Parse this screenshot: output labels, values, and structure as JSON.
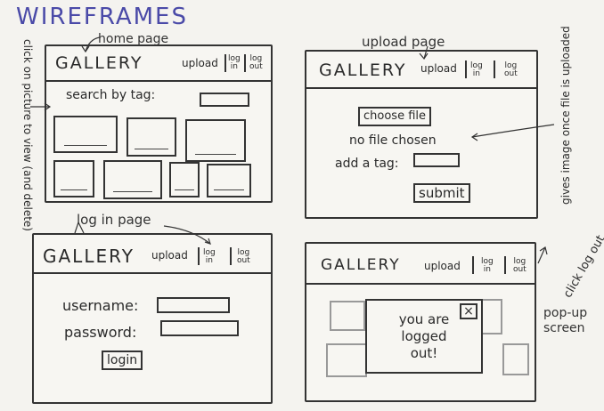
{
  "title": "WIREFRAMES",
  "notes": {
    "home_page": "home page",
    "upload_page": "upload page",
    "login_page": "log in page",
    "click_picture": "click on picture to view (and delete)",
    "gives_image": "gives image once file is uploaded",
    "click_logout": "click log out",
    "popup_screen": "pop-up screen"
  },
  "nav": {
    "gallery": "GALLERY",
    "upload": "upload",
    "login_top": "log",
    "login_bottom": "in",
    "logout_top": "log",
    "logout_bottom": "out"
  },
  "home": {
    "search_label": "search by tag:"
  },
  "upload": {
    "choose_file": "choose file",
    "no_file": "no file chosen",
    "add_tag": "add a tag:",
    "submit": "submit"
  },
  "login": {
    "username": "username:",
    "password": "password:",
    "login_button": "login"
  },
  "popup": {
    "close": "×",
    "line1": "you are",
    "line2": "logged",
    "line3": "out!"
  }
}
